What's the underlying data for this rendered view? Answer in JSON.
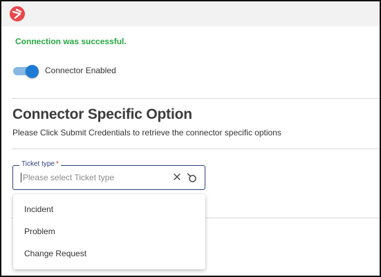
{
  "status": {
    "message": "Connection was successful.",
    "color": "#27a843"
  },
  "connector_toggle": {
    "label": "Connector Enabled",
    "enabled": true
  },
  "section": {
    "title": "Connector Specific Option",
    "description": "Please Click Submit Credentials to retrieve the connector specific options"
  },
  "ticket_type": {
    "label": "Ticket type",
    "required_marker": "*",
    "value": "",
    "placeholder": "Please select Ticket type"
  },
  "dropdown": {
    "options": [
      "Incident",
      "Problem",
      "Change Request"
    ]
  },
  "icons": {
    "logo": "brand-logo-icon",
    "clear": "close-icon",
    "search": "search-icon"
  },
  "colors": {
    "brand": "#e8474c",
    "accent": "#1d7bd4",
    "field_border": "#2c3f7c",
    "required": "#d9363e"
  }
}
